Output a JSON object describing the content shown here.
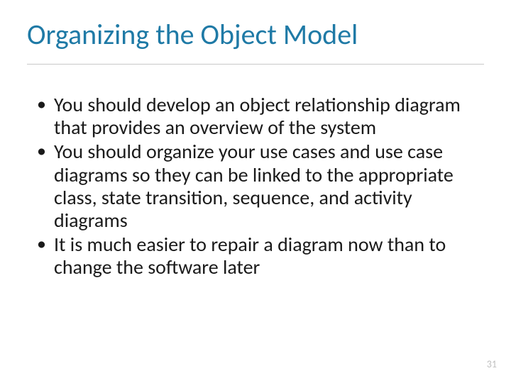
{
  "title": "Organizing the Object Model",
  "bullets": [
    "You should develop an object relationship diagram that provides an overview of the system",
    "You should organize your use cases and use case diagrams so they can be linked to the appropriate class, state transition, sequence, and activity diagrams",
    "It is much easier to repair a diagram now than to change the software later"
  ],
  "page_number": "31"
}
